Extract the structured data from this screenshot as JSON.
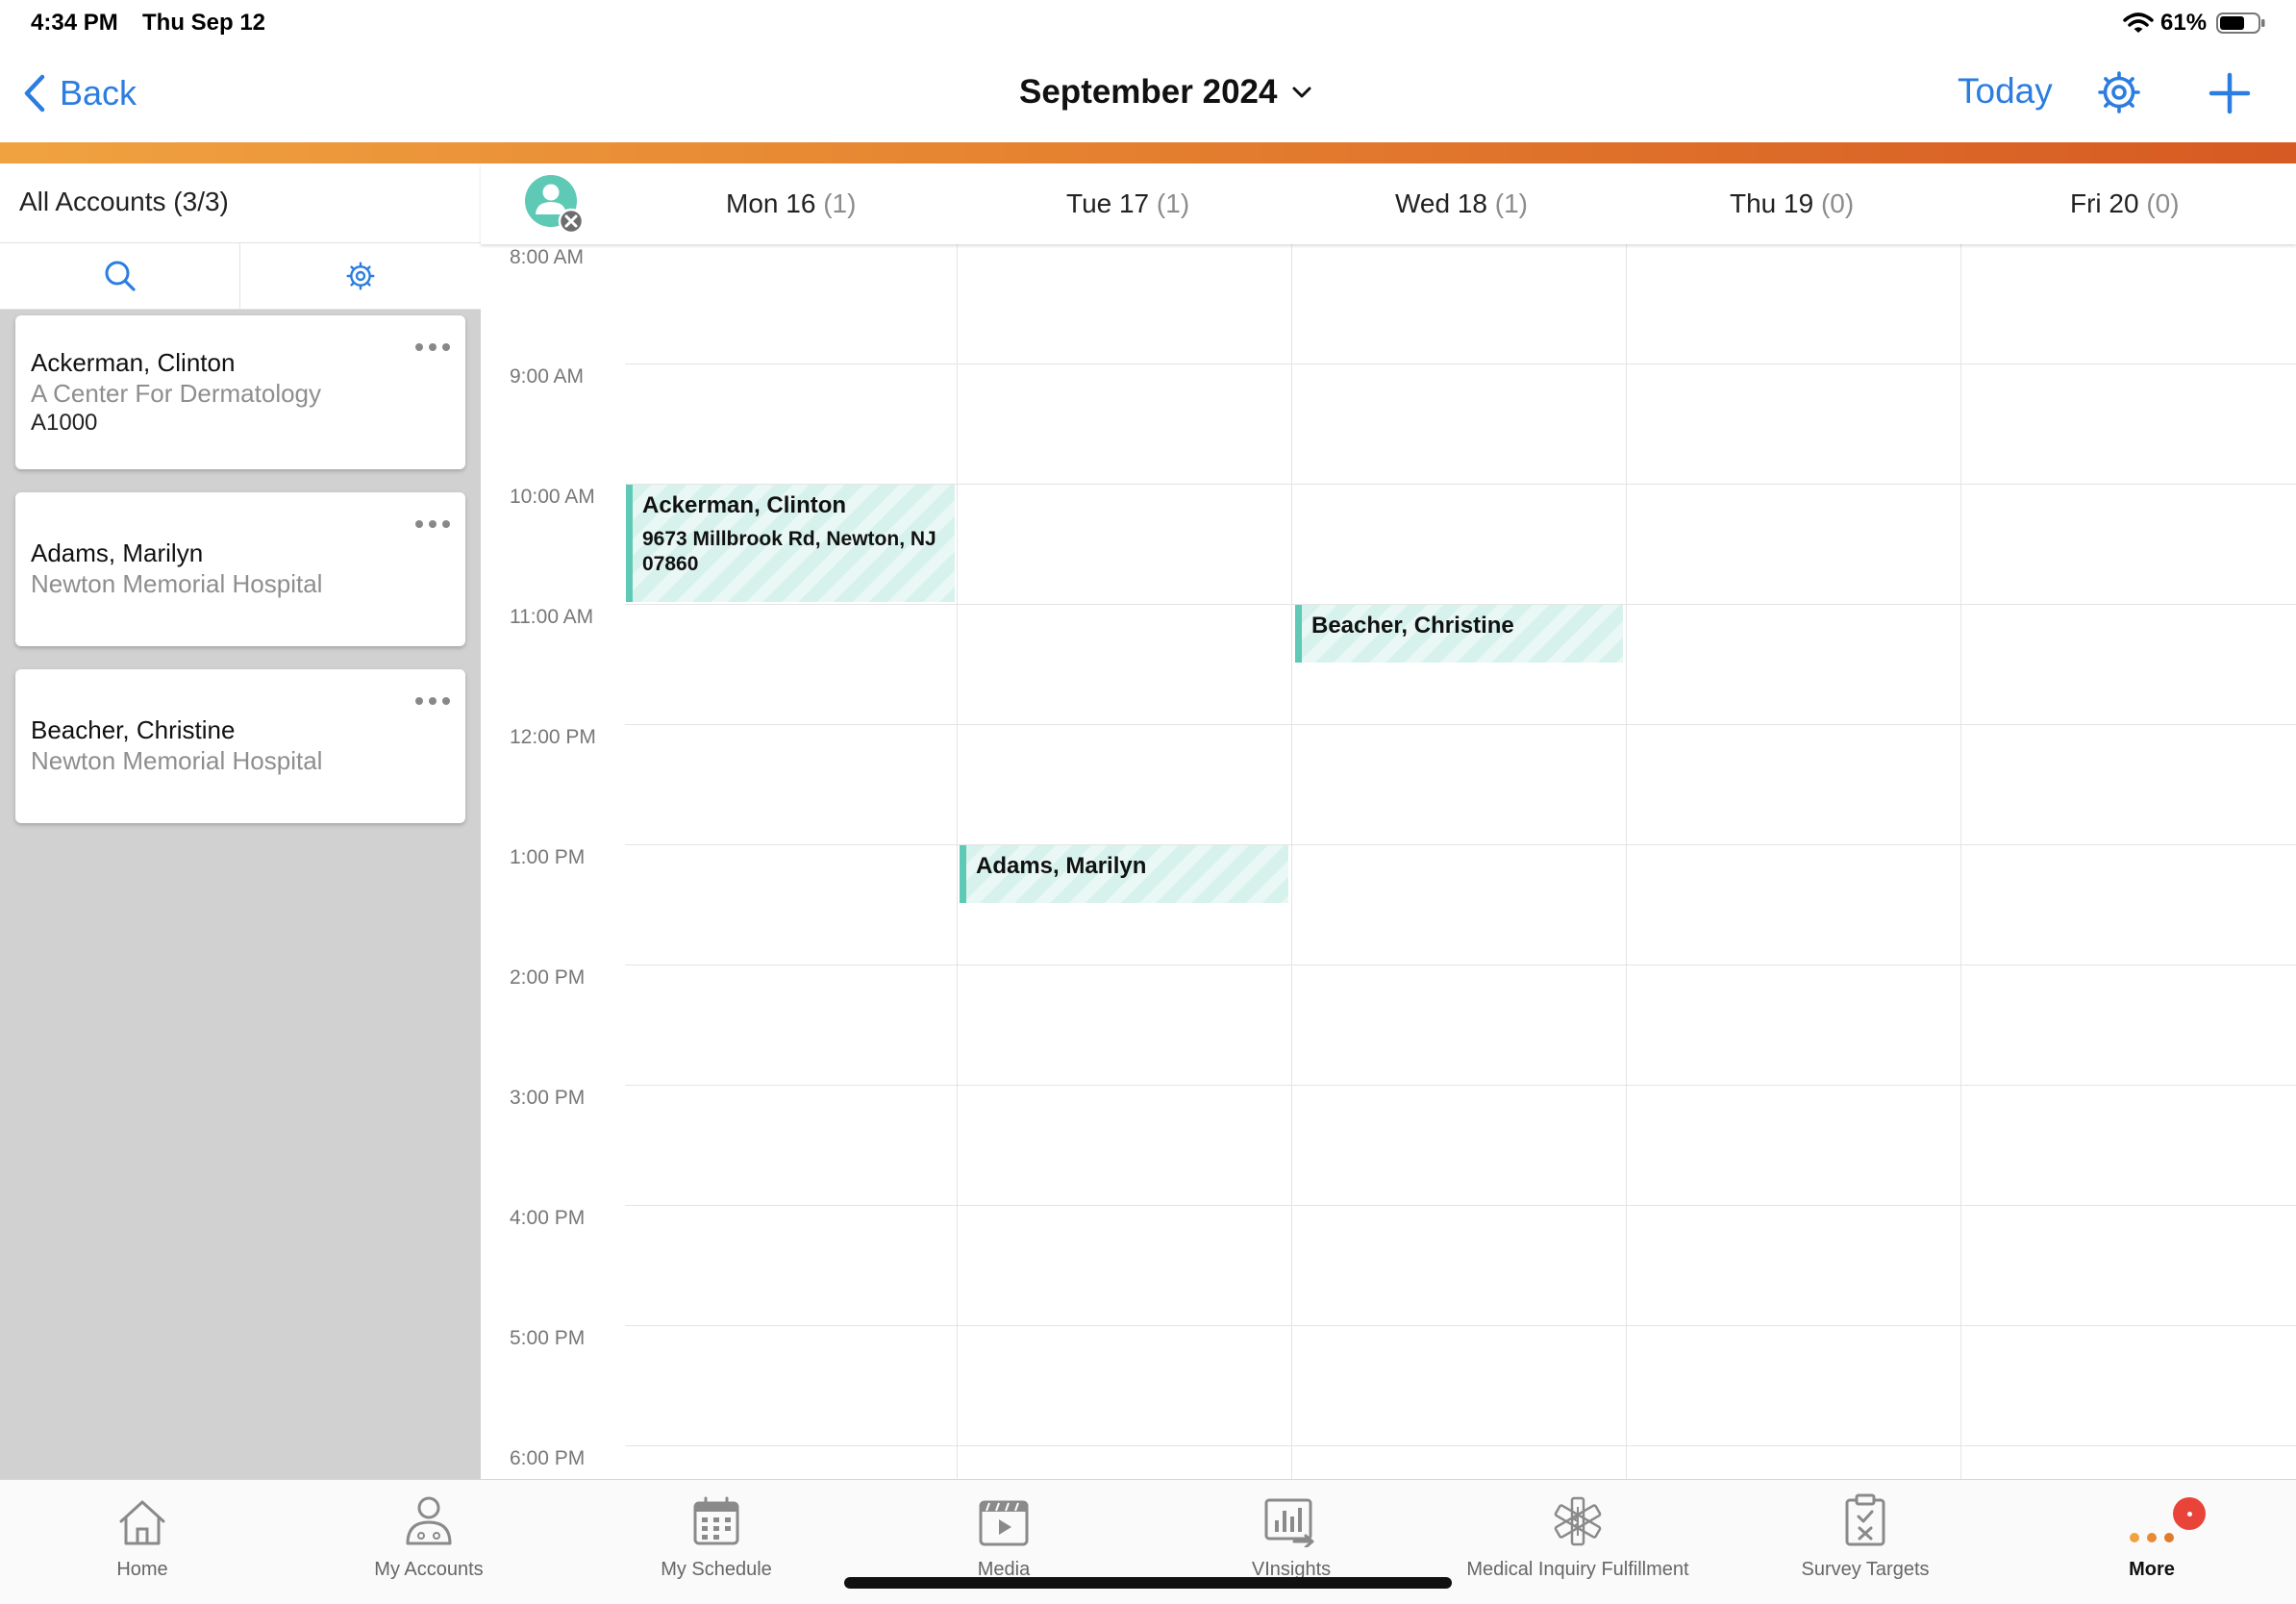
{
  "status_bar": {
    "time": "4:34 PM",
    "date": "Thu Sep 12",
    "battery": "61%"
  },
  "nav": {
    "back_label": "Back",
    "title": "September 2024",
    "today_label": "Today"
  },
  "accounts_panel": {
    "title": "All Accounts (3/3)",
    "accounts": [
      {
        "name": "Ackerman, Clinton",
        "org": "A Center For Dermatology",
        "code": "A1000"
      },
      {
        "name": "Adams, Marilyn",
        "org": "Newton Memorial Hospital"
      },
      {
        "name": "Beacher, Christine",
        "org": "Newton Memorial Hospital"
      }
    ]
  },
  "calendar": {
    "days": [
      {
        "label": "Mon 16",
        "count": "(1)"
      },
      {
        "label": "Tue 17",
        "count": "(1)"
      },
      {
        "label": "Wed 18",
        "count": "(1)"
      },
      {
        "label": "Thu 19",
        "count": "(0)"
      },
      {
        "label": "Fri 20",
        "count": "(0)"
      }
    ],
    "times": [
      "8:00 AM",
      "9:00 AM",
      "10:00 AM",
      "11:00 AM",
      "12:00 PM",
      "1:00 PM",
      "2:00 PM",
      "3:00 PM",
      "4:00 PM",
      "5:00 PM",
      "6:00 PM"
    ],
    "events": [
      {
        "title": "Ackerman, Clinton",
        "address": "9673 Millbrook Rd, Newton, NJ 07860"
      },
      {
        "title": "Beacher, Christine"
      },
      {
        "title": "Adams, Marilyn"
      }
    ],
    "accent_color": "#5ec9b4"
  },
  "tab_bar": {
    "items": [
      {
        "label": "Home",
        "icon": "home-icon"
      },
      {
        "label": "My Accounts",
        "icon": "person-icon"
      },
      {
        "label": "My Schedule",
        "icon": "calendar-icon"
      },
      {
        "label": "Media",
        "icon": "media-icon"
      },
      {
        "label": "VInsights",
        "icon": "chart-icon"
      },
      {
        "label": "Medical Inquiry Fulfillment",
        "icon": "medical-icon"
      },
      {
        "label": "Survey Targets",
        "icon": "clipboard-icon"
      },
      {
        "label": "More",
        "icon": "more-icon"
      }
    ],
    "active": "More"
  }
}
